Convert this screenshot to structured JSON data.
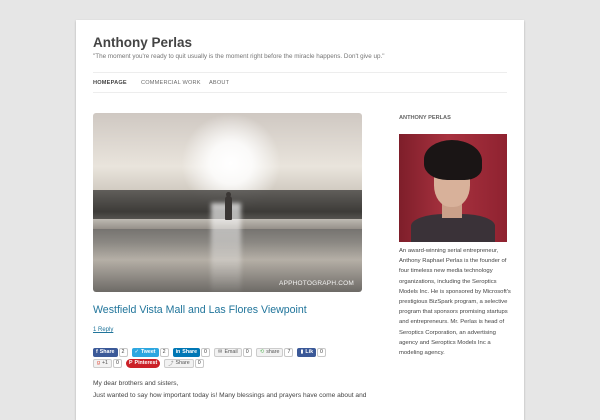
{
  "site": {
    "title": "Anthony Perlas",
    "description": "\"The moment you're ready to quit usually is the moment right before the miracle happens. Don't give up.\""
  },
  "nav": {
    "items": [
      "HOMEPAGE",
      "COMMERCIAL WORK",
      "ABOUT"
    ],
    "active": "HOMEPAGE"
  },
  "post": {
    "image_watermark": "APPHOTOGRAPH.COM",
    "title": "Westfield Vista Mall and Las Flores Viewpoint",
    "reply": "1 Reply",
    "share_row1": [
      {
        "label": "Share",
        "count": "2",
        "icon": "facebook-icon"
      },
      {
        "label": "Tweet",
        "count": "2",
        "icon": "twitter-icon"
      },
      {
        "label": "Share",
        "count": "0",
        "icon": "linkedin-icon"
      },
      {
        "label": "Email",
        "count": "0",
        "icon": "email-icon"
      },
      {
        "label": "share",
        "count": "7",
        "icon": "share-icon"
      },
      {
        "label": "Lik",
        "count": "0",
        "icon": "flattr-icon"
      }
    ],
    "share_row2": [
      {
        "label": "+1",
        "count": "0",
        "icon": "google-plus-icon"
      },
      {
        "label": "Pinterest",
        "count": "",
        "icon": "pinterest-icon"
      },
      {
        "label": "Share",
        "count": "0",
        "icon": "share-icon"
      }
    ],
    "body_lines": [
      "My dear brothers and sisters,",
      "Just wanted to say how important today is! Many blessings and prayers have come about and"
    ]
  },
  "sidebar": {
    "widget_title": "ANTHONY PERLAS",
    "bio": "An award-winning serial entrepreneur, Anthony Raphael Perlas is the founder of four timeless new media technology organizations, including the Seroptics Models Inc. He is sponsored by Microsoft's prestigious BizSpark program, a selective program that sponsors promising startups and entrepreneurs. Mr. Perlas is head of Seroptics Corporation, an advertising agency and Seroptics Models Inc a modeling agency."
  },
  "colors": {
    "link": "#21759b",
    "background": "#e6e6e6",
    "facebook": "#3b5998",
    "twitter": "#2ea7e0",
    "linkedin": "#0077b5",
    "pinterest": "#cb2027"
  }
}
